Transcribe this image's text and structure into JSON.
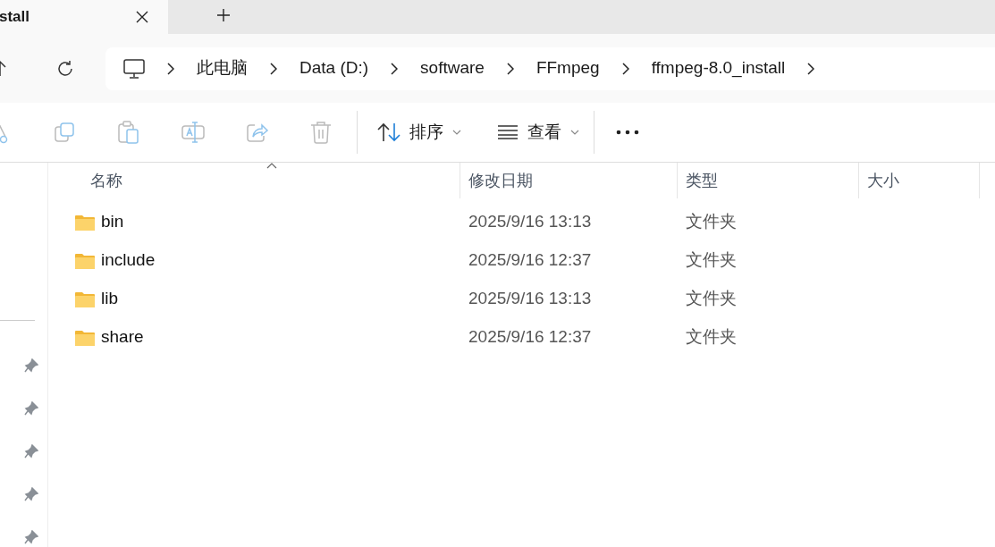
{
  "tab": {
    "title": "stall",
    "selected": true
  },
  "address": {
    "crumbs": [
      "此电脑",
      "Data (D:)",
      "software",
      "FFmpeg",
      "ffmpeg-8.0_install"
    ]
  },
  "toolbar": {
    "buttons": [
      {
        "label": "排序",
        "kind": "sort"
      },
      {
        "label": "查看",
        "kind": "view"
      }
    ]
  },
  "table": {
    "columns": [
      "名称",
      "修改日期",
      "类型",
      "大小"
    ],
    "rows": [
      {
        "name": "bin",
        "date": "2025/9/16 13:13",
        "type": "文件夹"
      },
      {
        "name": "include",
        "date": "2025/9/16 12:37",
        "type": "文件夹"
      },
      {
        "name": "lib",
        "date": "2025/9/16 13:13",
        "type": "文件夹"
      },
      {
        "name": "share",
        "date": "2025/9/16 12:37",
        "type": "文件夹"
      }
    ]
  }
}
